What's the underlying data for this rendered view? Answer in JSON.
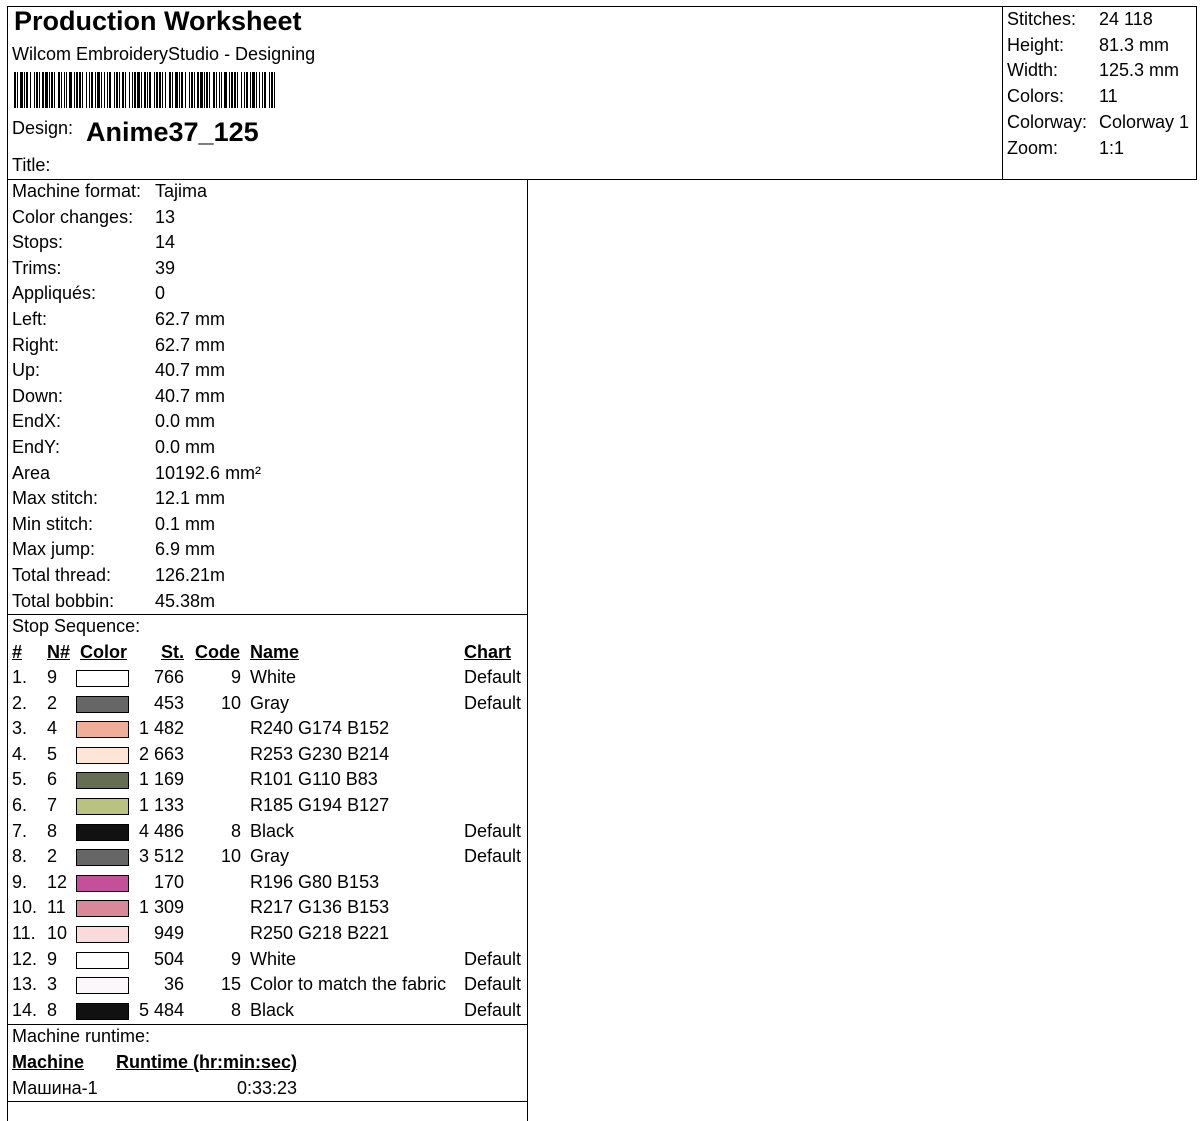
{
  "header": {
    "title": "Production Worksheet",
    "subtitle": "Wilcom EmbroideryStudio - Designing",
    "design_label": "Design:",
    "design_name": "Anime37_125",
    "title_label": "Title:"
  },
  "right_info": [
    {
      "label": "Stitches:",
      "value": "24 118"
    },
    {
      "label": "Height:",
      "value": "81.3 mm"
    },
    {
      "label": "Width:",
      "value": "125.3 mm"
    },
    {
      "label": "Colors:",
      "value": "11"
    },
    {
      "label": "Colorway:",
      "value": "Colorway 1"
    },
    {
      "label": "Zoom:",
      "value": "1:1"
    }
  ],
  "stats": [
    {
      "label": "Machine format:",
      "value": "Tajima"
    },
    {
      "label": "Color changes:",
      "value": "13"
    },
    {
      "label": "Stops:",
      "value": "14"
    },
    {
      "label": "Trims:",
      "value": "39"
    },
    {
      "label": "Appliqués:",
      "value": "0"
    },
    {
      "label": "Left:",
      "value": "62.7 mm"
    },
    {
      "label": "Right:",
      "value": "62.7 mm"
    },
    {
      "label": "Up:",
      "value": "40.7 mm"
    },
    {
      "label": "Down:",
      "value": "40.7 mm"
    },
    {
      "label": "EndX:",
      "value": "0.0 mm"
    },
    {
      "label": "EndY:",
      "value": "0.0 mm"
    },
    {
      "label": "Area",
      "value": "10192.6 mm²"
    },
    {
      "label": "Max stitch:",
      "value": "12.1 mm"
    },
    {
      "label": "Min stitch:",
      "value": "0.1 mm"
    },
    {
      "label": "Max jump:",
      "value": "6.9 mm"
    },
    {
      "label": "Total thread:",
      "value": "126.21m"
    },
    {
      "label": "Total bobbin:",
      "value": "45.38m"
    }
  ],
  "stop_sequence": {
    "heading": "Stop Sequence:",
    "columns": {
      "num": "#",
      "n": "N#",
      "color": "Color",
      "st": "St.",
      "code": "Code",
      "name": "Name",
      "chart": "Chart"
    },
    "rows": [
      {
        "num": "1.",
        "n": "9",
        "color": "#ffffff",
        "st": "766",
        "code": "9",
        "name": "White",
        "chart": "Default"
      },
      {
        "num": "2.",
        "n": "2",
        "color": "#666666",
        "st": "453",
        "code": "10",
        "name": "Gray",
        "chart": "Default"
      },
      {
        "num": "3.",
        "n": "4",
        "color": "#f0ae98",
        "st": "1 482",
        "code": "",
        "name": "R240 G174 B152",
        "chart": ""
      },
      {
        "num": "4.",
        "n": "5",
        "color": "#fde6d6",
        "st": "2 663",
        "code": "",
        "name": "R253 G230 B214",
        "chart": ""
      },
      {
        "num": "5.",
        "n": "6",
        "color": "#656e53",
        "st": "1 169",
        "code": "",
        "name": "R101 G110 B83",
        "chart": ""
      },
      {
        "num": "6.",
        "n": "7",
        "color": "#b9c27f",
        "st": "1 133",
        "code": "",
        "name": "R185 G194 B127",
        "chart": ""
      },
      {
        "num": "7.",
        "n": "8",
        "color": "#111111",
        "st": "4 486",
        "code": "8",
        "name": "Black",
        "chart": "Default"
      },
      {
        "num": "8.",
        "n": "2",
        "color": "#666666",
        "st": "3 512",
        "code": "10",
        "name": "Gray",
        "chart": "Default"
      },
      {
        "num": "9.",
        "n": "12",
        "color": "#c45099",
        "st": "170",
        "code": "",
        "name": "R196 G80 B153",
        "chart": ""
      },
      {
        "num": "10.",
        "n": "11",
        "color": "#d98899",
        "st": "1 309",
        "code": "",
        "name": "R217 G136 B153",
        "chart": ""
      },
      {
        "num": "11.",
        "n": "10",
        "color": "#fadadd",
        "st": "949",
        "code": "",
        "name": "R250 G218 B221",
        "chart": ""
      },
      {
        "num": "12.",
        "n": "9",
        "color": "#ffffff",
        "st": "504",
        "code": "9",
        "name": "White",
        "chart": "Default"
      },
      {
        "num": "13.",
        "n": "3",
        "color": "#fbf7fb",
        "st": "36",
        "code": "15",
        "name": "Color to match the fabric",
        "chart": "Default"
      },
      {
        "num": "14.",
        "n": "8",
        "color": "#111111",
        "st": "5 484",
        "code": "8",
        "name": "Black",
        "chart": "Default"
      }
    ]
  },
  "runtime": {
    "heading": "Machine runtime:",
    "col_machine": "Machine",
    "col_runtime": "Runtime (hr:min:sec)",
    "machine": "Машина-1",
    "time": "0:33:23"
  }
}
